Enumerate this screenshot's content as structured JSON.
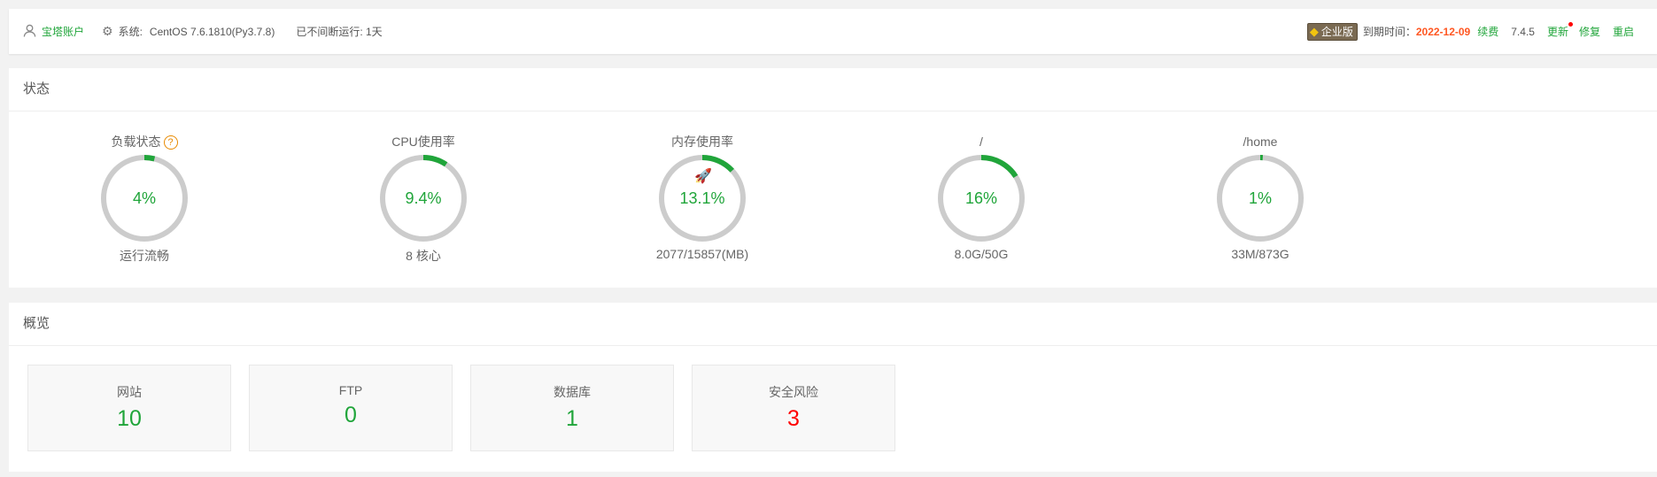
{
  "topbar": {
    "account": "宝塔账户",
    "system_label": "系统:",
    "system_value": "CentOS 7.6.1810(Py3.7.8)",
    "uptime": "已不间断运行: 1天",
    "edition": "企业版",
    "expire_label": "到期时间：",
    "expire_date": "2022-12-09",
    "renew": "续费",
    "version": "7.4.5",
    "update": "更新",
    "repair": "修复",
    "restart": "重启"
  },
  "state": {
    "title": "状态",
    "gauges": [
      {
        "title": "负载状态",
        "value": "4%",
        "percent": 4,
        "sub": "运行流畅",
        "help": "?"
      },
      {
        "title": "CPU使用率",
        "value": "9.4%",
        "percent": 9.4,
        "sub": "8 核心"
      },
      {
        "title": "内存使用率",
        "value": "13.1%",
        "percent": 13.1,
        "sub": "2077/15857(MB)"
      },
      {
        "title": "/",
        "value": "16%",
        "percent": 16,
        "sub": "8.0G/50G"
      },
      {
        "title": "/home",
        "value": "1%",
        "percent": 1,
        "sub": "33M/873G"
      }
    ]
  },
  "overview": {
    "title": "概览",
    "cards": [
      {
        "label": "网站",
        "value": "10"
      },
      {
        "label": "FTP",
        "value": "0"
      },
      {
        "label": "数据库",
        "value": "1"
      },
      {
        "label": "安全风险",
        "value": "3"
      }
    ]
  },
  "colors": {
    "accent": "#20a53a",
    "danger": "#ff0000",
    "expire": "#ff5722",
    "ring_bg": "#cccccc"
  },
  "icons": [
    "user-icon",
    "gear-icon",
    "diamond-icon",
    "question-icon",
    "rocket-icon"
  ]
}
